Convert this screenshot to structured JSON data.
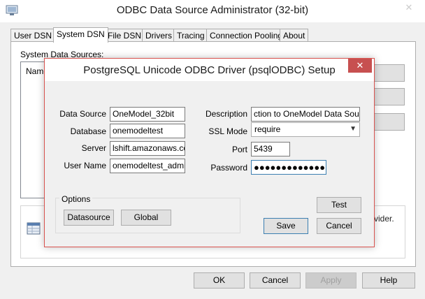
{
  "outer": {
    "title": "ODBC Data Source Administrator (32-bit)",
    "close_glyph": "✕",
    "tabs": [
      {
        "label": "User DSN"
      },
      {
        "label": "System DSN"
      },
      {
        "label": "File DSN"
      },
      {
        "label": "Drivers"
      },
      {
        "label": "Tracing"
      },
      {
        "label": "Connection Pooling"
      },
      {
        "label": "About"
      }
    ],
    "active_tab": "System DSN",
    "system_sources_label": "System Data Sources:",
    "list_header_name": "Name",
    "info_text_partial": "vider.",
    "buttons": {
      "ok": "OK",
      "cancel": "Cancel",
      "apply": "Apply",
      "help": "Help"
    }
  },
  "dialog": {
    "title": "PostgreSQL Unicode ODBC Driver (psqlODBC) Setup",
    "close_glyph": "✕",
    "labels": {
      "data_source": "Data Source",
      "database": "Database",
      "server": "Server",
      "user_name": "User Name",
      "description": "Description",
      "ssl_mode": "SSL Mode",
      "port": "Port",
      "password": "Password",
      "options": "Options"
    },
    "values": {
      "data_source": "OneModel_32bit",
      "database": "onemodeltest",
      "server": "lshift.amazonaws.com",
      "user_name": "onemodeltest_admin",
      "description": "ction to OneModel Data Source",
      "ssl_mode": "require",
      "port": "5439",
      "password_mask": "●●●●●●●●●●●●●"
    },
    "buttons": {
      "datasource": "Datasource",
      "global": "Global",
      "test": "Test",
      "save": "Save",
      "cancel": "Cancel"
    }
  },
  "colors": {
    "dialog_close_bg": "#c75050",
    "focus_border": "#3c7fb1",
    "window_bg": "#f0f0f0"
  }
}
